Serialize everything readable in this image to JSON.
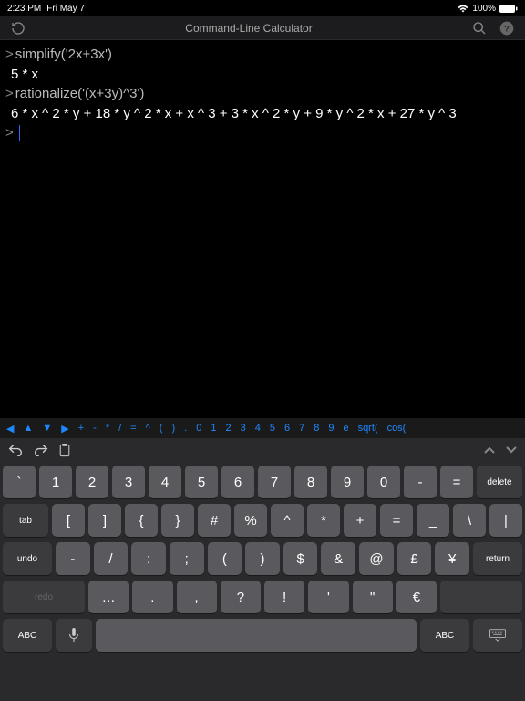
{
  "status": {
    "time": "2:23 PM",
    "date": "Fri May 7",
    "battery": "100%"
  },
  "nav": {
    "title": "Command-Line Calculator"
  },
  "console": {
    "lines": [
      {
        "type": "input",
        "text": "simplify('2x+3x')"
      },
      {
        "type": "output",
        "text": "5 * x"
      },
      {
        "type": "input",
        "text": "rationalize('(x+3y)^3')"
      },
      {
        "type": "output",
        "text": "6 * x ^ 2 * y + 18 * y ^ 2 * x + x ^ 3 + 3 * x ^ 2 * y + 9 * y ^ 2 * x + 27 * y ^ 3"
      }
    ],
    "prompt": ">"
  },
  "toolbar": {
    "items": [
      "◀",
      "▲",
      "▼",
      "▶",
      "+",
      "-",
      "*",
      "/",
      "=",
      "^",
      "(",
      ")",
      ".",
      "0",
      "1",
      "2",
      "3",
      "4",
      "5",
      "6",
      "7",
      "8",
      "9",
      "e",
      "sqrt(",
      "cos("
    ]
  },
  "keyboard": {
    "row1": [
      "`",
      "1",
      "2",
      "3",
      "4",
      "5",
      "6",
      "7",
      "8",
      "9",
      "0",
      "-",
      "="
    ],
    "delete": "delete",
    "tab": "tab",
    "row2": [
      "[",
      "]",
      "{",
      "}",
      "#",
      "%",
      "^",
      "*",
      "+",
      "=",
      "_",
      "\\",
      "|"
    ],
    "undo": "undo",
    "row3": [
      "-",
      "/",
      ":",
      ";",
      "(",
      ")",
      "$",
      "&",
      "@",
      "£",
      "¥"
    ],
    "return": "return",
    "redo": "redo",
    "row4": [
      "…",
      ".",
      ",",
      "?",
      "!",
      "'",
      "\"",
      "€"
    ],
    "abc": "ABC"
  }
}
